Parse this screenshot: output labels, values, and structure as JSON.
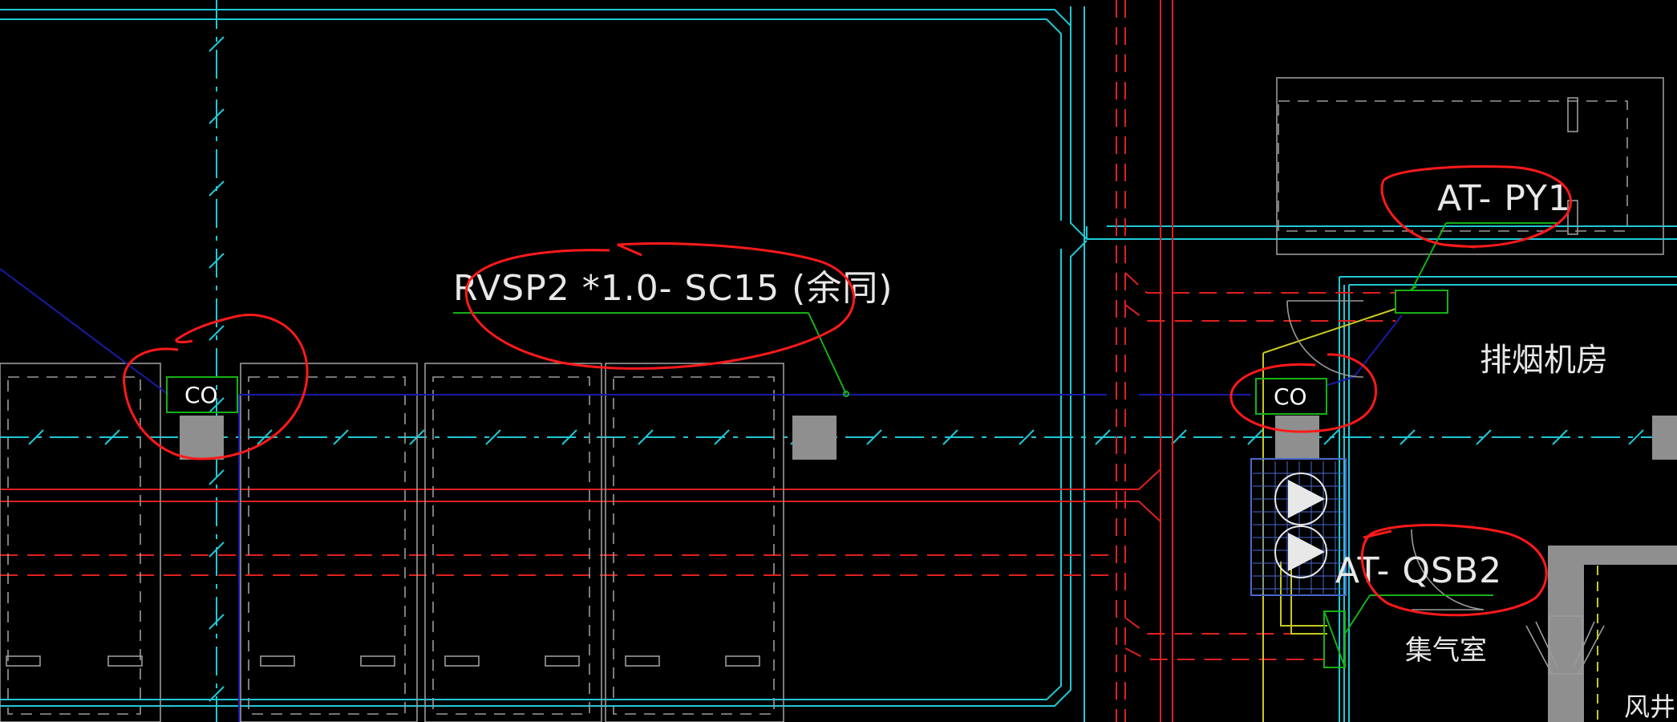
{
  "colors": {
    "background": "#000000",
    "wall_cyan": "#1fc9d6",
    "pipe_red": "#e02020",
    "wire_blue": "#1a1aa8",
    "leader_green": "#16b116",
    "annotation_red": "#ff1a1a",
    "column_grey": "#8f8f8f",
    "text": "#e8e8e8"
  },
  "labels": {
    "cable_spec": "RVSP2 *1.0- SC15 (余同)",
    "panel_py1": "AT- PY1",
    "panel_qsb2": "AT- QSB2",
    "co_left": "CO",
    "co_right": "CO"
  },
  "rooms": {
    "smoke_exhaust": "排烟机房",
    "gas_collection": "集气室",
    "air_shaft": "风井"
  }
}
